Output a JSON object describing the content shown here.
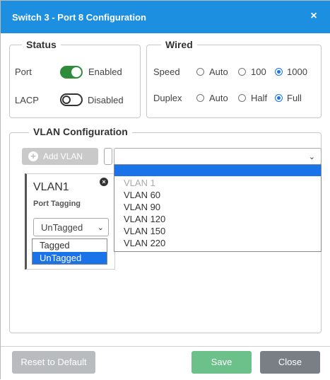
{
  "window": {
    "title": "Switch 3 - Port 8 Configuration",
    "close_glyph": "×"
  },
  "status": {
    "legend": "Status",
    "port_label": "Port",
    "port_state": "Enabled",
    "lacp_label": "LACP",
    "lacp_state": "Disabled"
  },
  "wired": {
    "legend": "Wired",
    "speed_label": "Speed",
    "speed_options": [
      "Auto",
      "100",
      "1000"
    ],
    "speed_selected": "1000",
    "duplex_label": "Duplex",
    "duplex_options": [
      "Auto",
      "Half",
      "Full"
    ],
    "duplex_selected": "Full"
  },
  "vlan": {
    "legend": "VLAN Configuration",
    "add_button": "Add VLAN",
    "vlan_select_value": "",
    "vlan_options": [
      "VLAN 1",
      "VLAN 60",
      "VLAN 90",
      "VLAN 120",
      "VLAN 150",
      "VLAN 220"
    ],
    "disabled_option": "VLAN 1",
    "card": {
      "name": "VLAN1",
      "port_tagging_label": "Port Tagging",
      "tagging_value": "UnTagged",
      "tagging_options": [
        "Tagged",
        "UnTagged"
      ],
      "tagging_selected": "UnTagged"
    }
  },
  "footer": {
    "reset_label": "Reset to Default",
    "save_label": "Save",
    "close_label": "Close"
  },
  "colors": {
    "titlebar": "#1d8fe0",
    "toggle_on": "#2e8b3a",
    "selection": "#1a73e8",
    "save_button": "#6cc089",
    "close_button": "#7a7f85",
    "reset_button": "#b9bcbf"
  }
}
